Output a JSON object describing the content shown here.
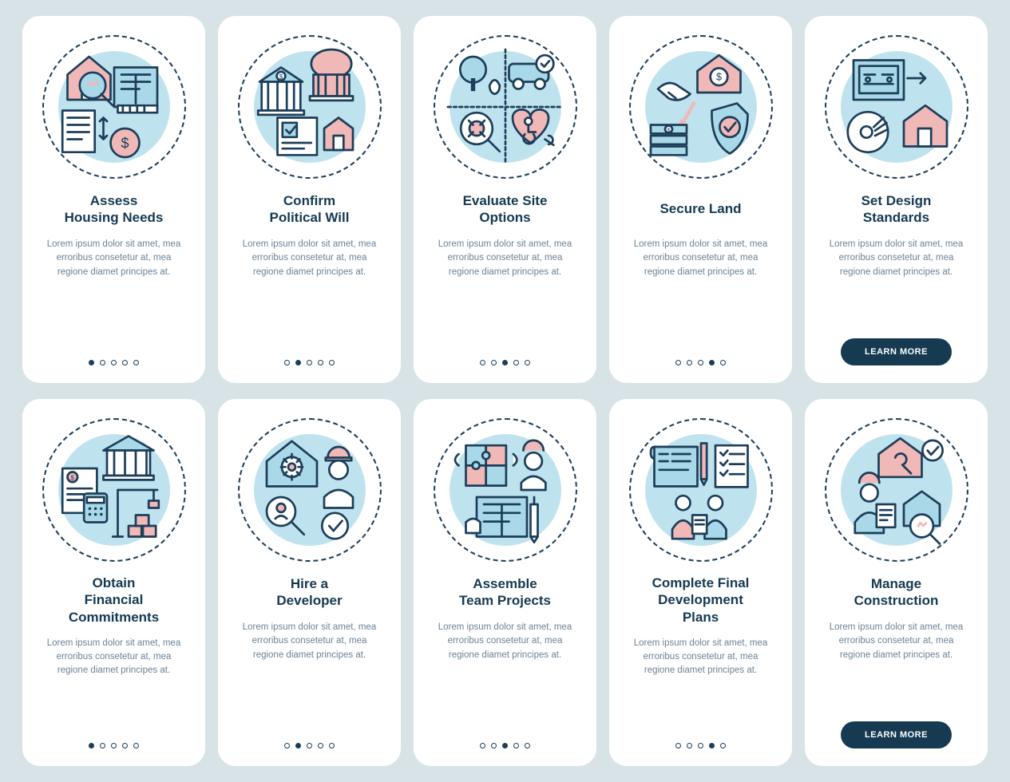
{
  "lorem": "Lorem ipsum dolor sit amet, mea erroribus consetetur at, mea regione diamet principes at.",
  "cta_label": "LEARN MORE",
  "colors": {
    "stroke": "#1c3e5a",
    "fill_blue": "#a9d9e8",
    "fill_pink": "#f0b8b6",
    "accent_blue": "#4f9bc7"
  },
  "cards": [
    {
      "title": "Assess\nHousing Needs",
      "active_dot": 0,
      "has_cta": false
    },
    {
      "title": "Confirm\nPolitical Will",
      "active_dot": 1,
      "has_cta": false
    },
    {
      "title": "Evaluate Site\nOptions",
      "active_dot": 2,
      "has_cta": false
    },
    {
      "title": "Secure Land",
      "active_dot": 3,
      "has_cta": false
    },
    {
      "title": "Set Design\nStandards",
      "active_dot": null,
      "has_cta": true
    },
    {
      "title": "Obtain\nFinancial\nCommitments",
      "active_dot": 0,
      "has_cta": false
    },
    {
      "title": "Hire a\nDeveloper",
      "active_dot": 1,
      "has_cta": false
    },
    {
      "title": "Assemble\nTeam Projects",
      "active_dot": 2,
      "has_cta": false
    },
    {
      "title": "Complete Final\nDevelopment\nPlans",
      "active_dot": 3,
      "has_cta": false
    },
    {
      "title": "Manage\nConstruction",
      "active_dot": null,
      "has_cta": true
    }
  ]
}
